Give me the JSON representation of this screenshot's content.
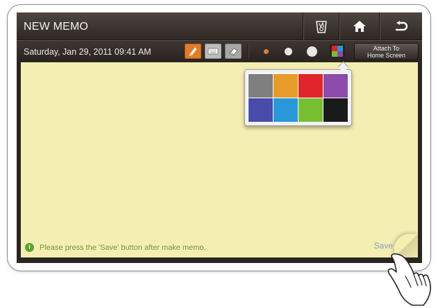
{
  "app": {
    "title": "NEW MEMO"
  },
  "titlebar": {
    "icons": [
      "trash-bin-icon",
      "home-icon",
      "back-icon"
    ]
  },
  "toolbar": {
    "datetime": "Saturday, Jan 29, 2011 09:41 AM",
    "tools": [
      {
        "name": "pen-icon",
        "active": true
      },
      {
        "name": "keyboard-icon",
        "active": false
      },
      {
        "name": "eraser-icon",
        "active": false
      }
    ],
    "brush_sizes": [
      "small",
      "medium",
      "large"
    ],
    "selected_brush_color": "#e37c2a",
    "attach_label_line1": "Attach To",
    "attach_label_line2": "Home Screen"
  },
  "palette": {
    "colors": [
      "#7f7f80",
      "#e69b2a",
      "#e0252c",
      "#8d4bab",
      "#4b4bab",
      "#2a97d8",
      "#78be32",
      "#1a1a1a"
    ]
  },
  "memo": {
    "hint": "Please press the 'Save' button after make memo.",
    "save_label": "Save",
    "paper_color": "#f5eeb3"
  }
}
